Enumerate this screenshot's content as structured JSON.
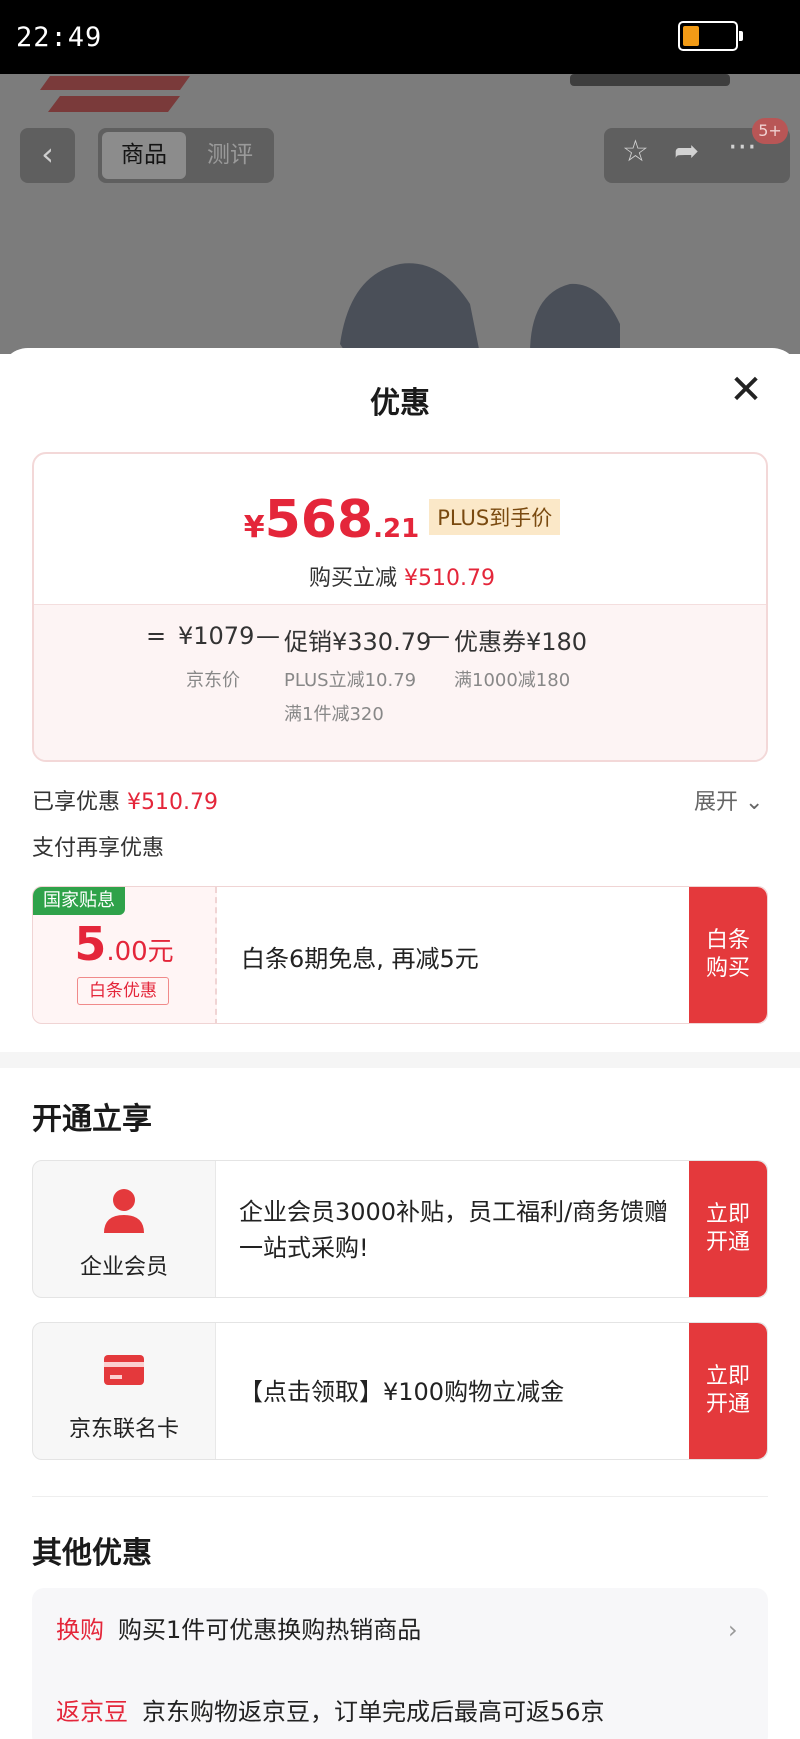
{
  "status_bar": {
    "time": "22:49",
    "battery_level": 0.25
  },
  "background": {
    "tabs": [
      "商品",
      "测评"
    ],
    "cart_badge": "5+"
  },
  "sheet": {
    "title": "优惠",
    "price": {
      "symbol": "¥",
      "integer": "568",
      "decimal": ".21",
      "tag": "PLUS到手价",
      "reduce_label": "购买立减",
      "reduce_value": "¥510.79"
    },
    "formula": {
      "eq": "=",
      "minus": "—",
      "jd_price": "¥1079",
      "jd_price_label": "京东价",
      "promo": "促销¥330.79",
      "promo_sub1": "PLUS立减10.79",
      "promo_sub2": "满1件减320",
      "coupon": "优惠券¥180",
      "coupon_sub": "满1000减180"
    },
    "enjoyed_label": "已享优惠",
    "enjoyed_value": "¥510.79",
    "expand": "展开",
    "pay_more": "支付再享优惠",
    "pay_coupon": {
      "tag": "国家贴息",
      "amount": "5",
      "amount_decimal": ".00元",
      "sub_tag": "白条优惠",
      "desc": "白条6期免息, 再减5元",
      "button": [
        "白条",
        "购买"
      ]
    },
    "open_section": {
      "heading": "开通立享",
      "items": [
        {
          "icon": "person-icon",
          "label": "企业会员",
          "desc": "企业会员3000补贴，员工福利/商务馈赠一站式采购!",
          "button": [
            "立即",
            "开通"
          ]
        },
        {
          "icon": "card-icon",
          "label": "京东联名卡",
          "desc": "【点击领取】¥100购物立减金",
          "button": [
            "立即",
            "开通"
          ]
        }
      ]
    },
    "other_section": {
      "heading": "其他优惠",
      "rows": [
        {
          "key": "换购",
          "text": "购买1件可优惠换购热销商品"
        },
        {
          "key": "返京豆",
          "text": "京东购物返京豆，订单完成后最高可返56京"
        }
      ]
    }
  },
  "colors": {
    "accent_red": "#e4263a",
    "button_red": "#e4393c",
    "gov_green": "#2fa24a"
  }
}
